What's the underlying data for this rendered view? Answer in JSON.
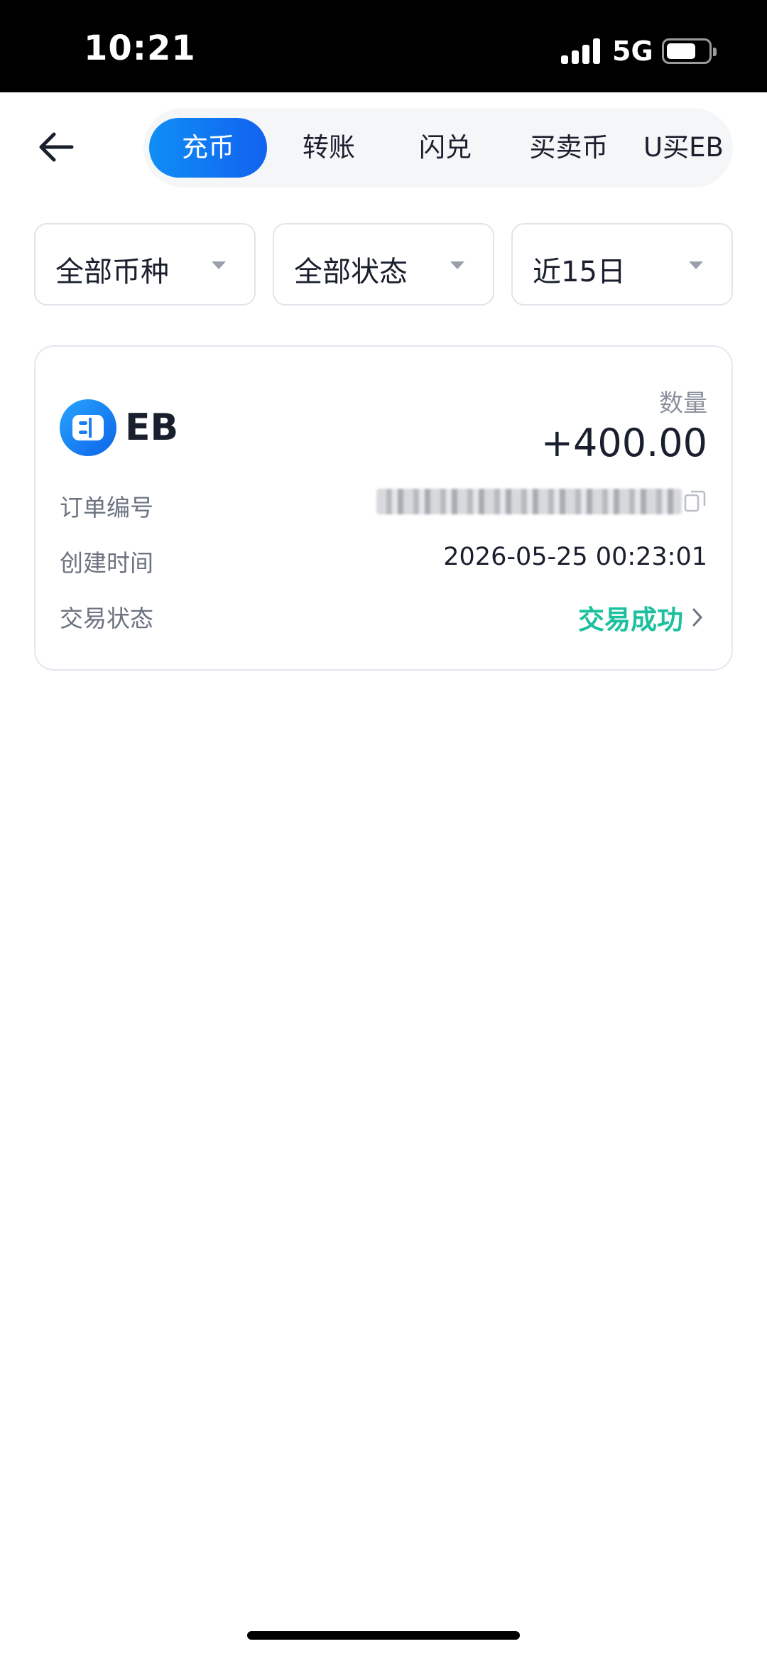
{
  "status_bar": {
    "time": "10:21",
    "network": "5G"
  },
  "tabs": [
    {
      "label": "充币",
      "active": true
    },
    {
      "label": "转账",
      "active": false
    },
    {
      "label": "闪兑",
      "active": false
    },
    {
      "label": "买卖币",
      "active": false
    },
    {
      "label": "U买EB",
      "active": false
    }
  ],
  "filters": {
    "coin": "全部币种",
    "status": "全部状态",
    "period": "近15日"
  },
  "record": {
    "coin": "EB",
    "quantity_label": "数量",
    "quantity": "+400.00",
    "order_no_label": "订单编号",
    "created_label": "创建时间",
    "created_time": "2026-05-25 00:23:01",
    "status_label": "交易状态",
    "status": "交易成功"
  },
  "colors": {
    "accent": "#1262ef",
    "success": "#1cc09c"
  },
  "icons": {
    "back": "arrow-left-icon",
    "coin": "eb-coin-icon",
    "copy": "copy-icon",
    "chevron": "chevron-right-icon"
  }
}
